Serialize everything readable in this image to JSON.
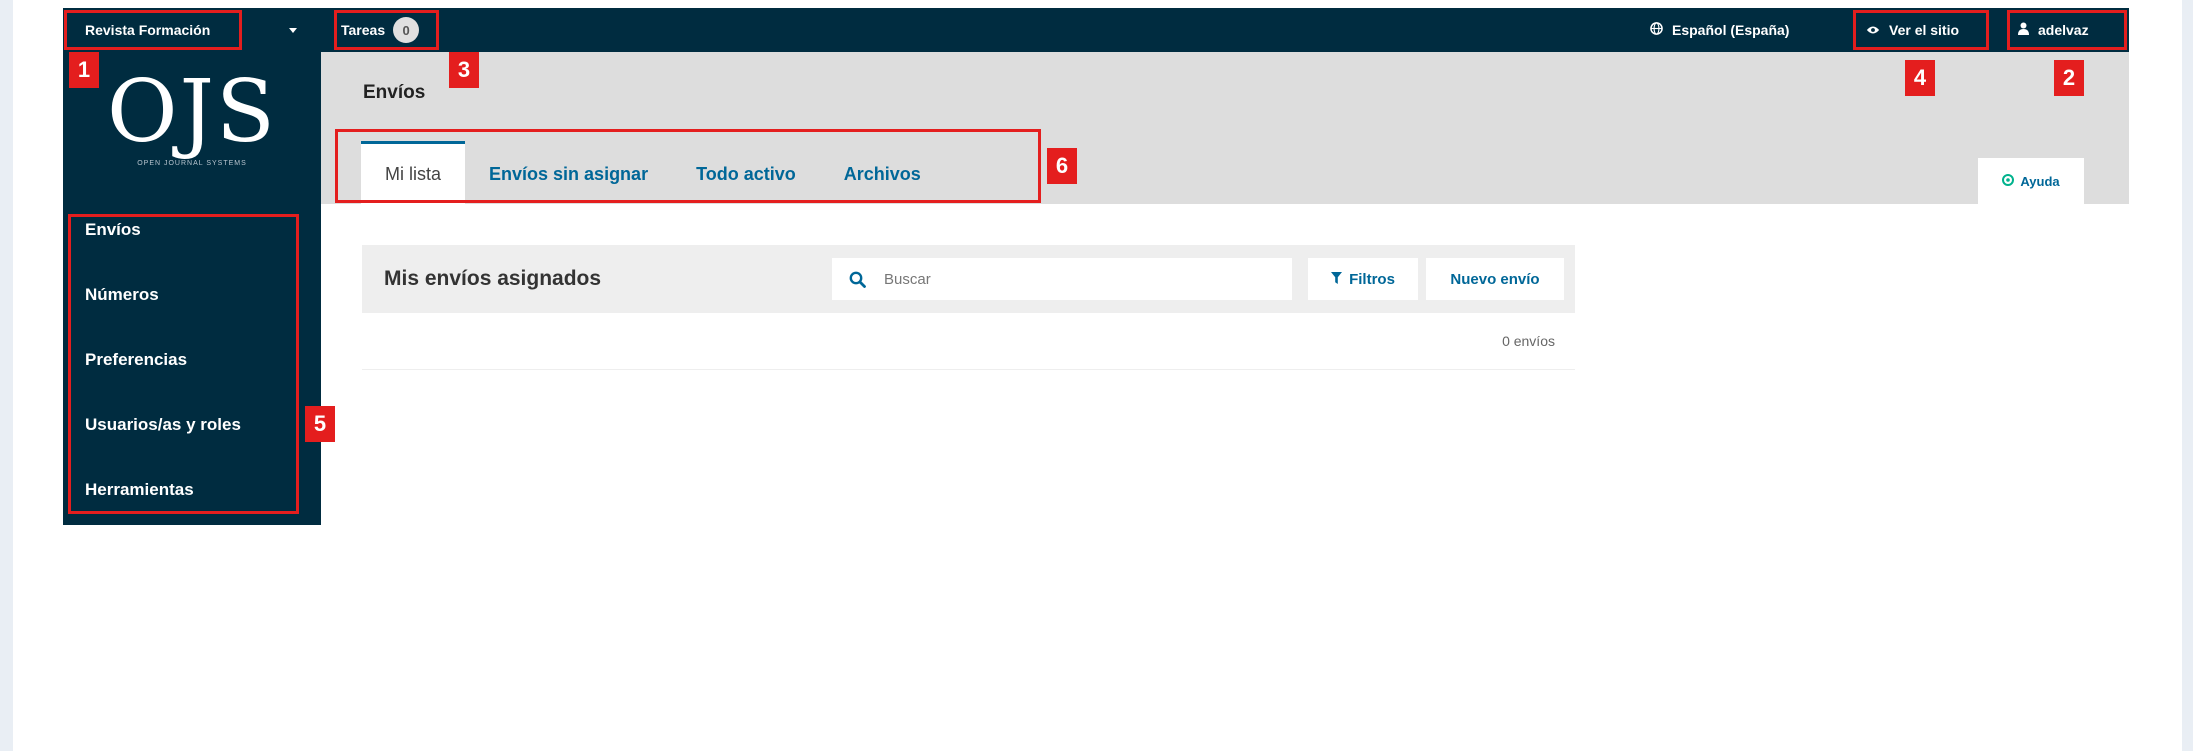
{
  "topbar": {
    "journal_name": "Revista Formación",
    "tasks_label": "Tareas",
    "tasks_count": "0",
    "language_label": "Español (España)",
    "view_site_label": "Ver el sitio",
    "user_label": "adelvaz"
  },
  "sidebar": {
    "logo_text": "OJS",
    "logo_subtitle": "OPEN JOURNAL SYSTEMS",
    "items": [
      {
        "label": "Envíos"
      },
      {
        "label": "Números"
      },
      {
        "label": "Preferencias"
      },
      {
        "label": "Usuarios/as y roles"
      },
      {
        "label": "Herramientas"
      }
    ]
  },
  "header": {
    "title": "Envíos",
    "tabs": [
      {
        "label": "Mi lista",
        "active": true
      },
      {
        "label": "Envíos sin asignar",
        "active": false
      },
      {
        "label": "Todo activo",
        "active": false
      },
      {
        "label": "Archivos",
        "active": false
      }
    ],
    "help_label": "Ayuda"
  },
  "submissions": {
    "title": "Mis envíos asignados",
    "search_placeholder": "Buscar",
    "filters_label": "Filtros",
    "new_submission_label": "Nuevo envío",
    "count_text": "0 envíos"
  },
  "annotations": [
    "1",
    "2",
    "3",
    "4",
    "5",
    "6"
  ],
  "colors": {
    "navy": "#002c40",
    "link_blue": "#006798",
    "header_gray": "#dddddd",
    "annotation_red": "#e41e1e",
    "help_green": "#00b28d"
  },
  "icons": [
    "chevron-down-icon",
    "globe-icon",
    "eye-icon",
    "user-icon",
    "help-icon",
    "search-icon",
    "filter-icon"
  ]
}
